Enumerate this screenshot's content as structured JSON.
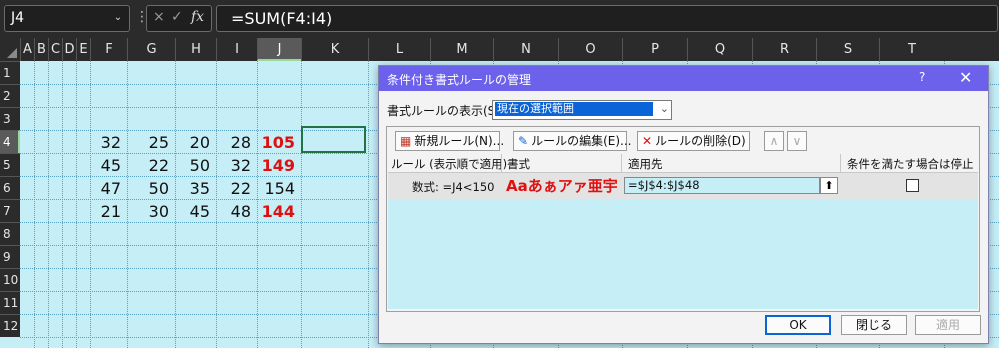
{
  "formula_bar": {
    "name_box": "J4",
    "formula": "=SUM(F4:I4)",
    "dots": "⋮",
    "cancel_icon": "×",
    "enter_icon": "✓",
    "fx_label": "fx"
  },
  "columns": [
    "A",
    "B",
    "C",
    "D",
    "E",
    "F",
    "G",
    "H",
    "I",
    "J",
    "K",
    "L",
    "M",
    "N",
    "O",
    "P",
    "Q",
    "R",
    "S",
    "T"
  ],
  "rows": [
    "1",
    "2",
    "3",
    "4",
    "5",
    "6",
    "7",
    "8",
    "9",
    "10",
    "11",
    "12"
  ],
  "cells": [
    {
      "F": "32",
      "G": "25",
      "H": "20",
      "I": "28",
      "J": "105",
      "J_red": true
    },
    {
      "F": "45",
      "G": "22",
      "H": "50",
      "I": "32",
      "J": "149",
      "J_red": true
    },
    {
      "F": "47",
      "G": "50",
      "H": "35",
      "I": "22",
      "J": "154",
      "J_red": false
    },
    {
      "F": "21",
      "G": "30",
      "H": "45",
      "I": "48",
      "J": "144",
      "J_red": true
    }
  ],
  "dialog": {
    "title": "条件付き書式ルールの管理",
    "help": "?",
    "close": "✕",
    "show_rules_label": "書式ルールの表示(S):",
    "show_rules_value": "現在の選択範囲",
    "buttons": {
      "new_rule": "新規ルール(N)...",
      "edit_rule": "ルールの編集(E)...",
      "delete_rule": "ルールの削除(D)",
      "move_up": "∧",
      "move_down": "∨"
    },
    "columns": {
      "rule": "ルール (表示順で適用)",
      "format": "書式",
      "applies_to": "適用先",
      "stop_if_true": "条件を満たす場合は停止"
    },
    "rule": {
      "condition": "数式: =J4<150",
      "format_preview": "Aaあぁアァ亜宇",
      "applies_to": "=$J$4:$J$48",
      "upload_icon": "⬆"
    },
    "footer": {
      "ok": "OK",
      "close": "閉じる",
      "apply": "適用"
    }
  }
}
